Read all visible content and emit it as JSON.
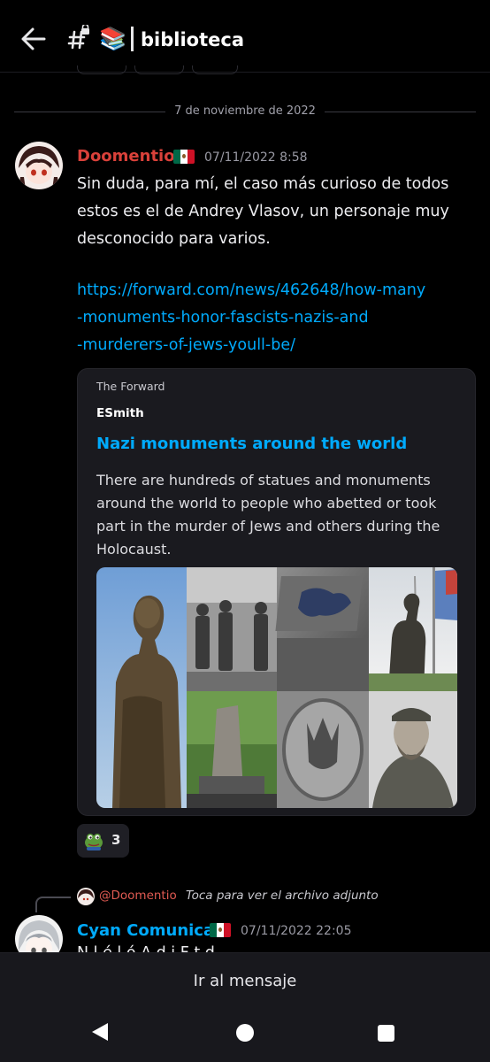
{
  "header": {
    "channel_emoji": "📚",
    "channel_name": "biblioteca",
    "icons": [
      "back-arrow-icon",
      "locked-hashtag-icon"
    ]
  },
  "date_divider": "7 de noviembre de 2022",
  "message1": {
    "author": "Doomentio",
    "author_color": "#d9413a",
    "timestamp": "07/11/2022 8:58",
    "text": "Sin duda, para mí, el caso más curioso de todos estos es el de Andrey Vlasov, un personaje muy desconocido para varios.",
    "link_lines": [
      "https://forward.com/news/462648/how-many",
      "-monuments-honor-fascists-nazis-and",
      "-murderers-of-jews-youll-be/"
    ],
    "embed": {
      "provider": "The Forward",
      "author": "ESmith",
      "title": "Nazi monuments around the world",
      "description": "There are hundreds of statues and monuments around the world to people who abetted or took part in the murder of Jews and others during the Holocaust."
    },
    "reaction": {
      "icon": "pepe-frog-emoji",
      "count": "3"
    }
  },
  "reply": {
    "reply_to_user": "@Doomentio",
    "reply_text": "Toca para ver el archivo adjunto"
  },
  "message2": {
    "author": "Cyan Comunica",
    "author_color": "#00aafc",
    "timestamp": "07/11/2022 22:05",
    "partial_text": "N   l      é  l  ó    A d  i F           t     d"
  },
  "bottom": {
    "jump_label": "Ir al mensaje"
  },
  "colors": {
    "background": "#000000",
    "link": "#00aafc",
    "embed_bg": "#1a1a1f"
  }
}
